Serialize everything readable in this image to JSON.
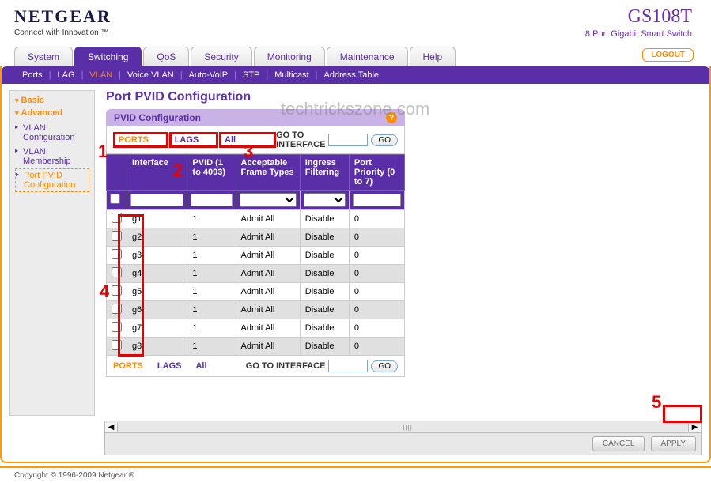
{
  "brand": {
    "name": "NETGEAR",
    "tagline": "Connect with Innovation ™"
  },
  "device": {
    "model": "GS108T",
    "description": "8 Port Gigabit Smart Switch"
  },
  "logout_label": "LOGOUT",
  "main_tabs": [
    "System",
    "Switching",
    "QoS",
    "Security",
    "Monitoring",
    "Maintenance",
    "Help"
  ],
  "main_tabs_active": "Switching",
  "sub_tabs": [
    "Ports",
    "LAG",
    "VLAN",
    "Voice VLAN",
    "Auto-VoIP",
    "STP",
    "Multicast",
    "Address Table"
  ],
  "sub_tabs_active": "VLAN",
  "sidebar": {
    "sections": [
      {
        "label": "Basic",
        "items": []
      },
      {
        "label": "Advanced",
        "items": [
          "VLAN Configuration",
          "VLAN Membership",
          "Port PVID Configuration"
        ],
        "current": "Port PVID Configuration"
      }
    ]
  },
  "page_title": "Port PVID Configuration",
  "panel_title": "PVID Configuration",
  "filters": {
    "links": [
      "PORTS",
      "LAGS",
      "All"
    ],
    "active": "PORTS",
    "goto_label": "GO TO INTERFACE",
    "go_btn": "GO"
  },
  "columns": [
    "Interface",
    "PVID (1 to 4093)",
    "Acceptable Frame Types",
    "Ingress Filtering",
    "Port Priority (0 to 7)"
  ],
  "rows": [
    {
      "interface": "g1",
      "pvid": "1",
      "frame": "Admit All",
      "ingress": "Disable",
      "priority": "0"
    },
    {
      "interface": "g2",
      "pvid": "1",
      "frame": "Admit All",
      "ingress": "Disable",
      "priority": "0"
    },
    {
      "interface": "g3",
      "pvid": "1",
      "frame": "Admit All",
      "ingress": "Disable",
      "priority": "0"
    },
    {
      "interface": "g4",
      "pvid": "1",
      "frame": "Admit All",
      "ingress": "Disable",
      "priority": "0"
    },
    {
      "interface": "g5",
      "pvid": "1",
      "frame": "Admit All",
      "ingress": "Disable",
      "priority": "0"
    },
    {
      "interface": "g6",
      "pvid": "1",
      "frame": "Admit All",
      "ingress": "Disable",
      "priority": "0"
    },
    {
      "interface": "g7",
      "pvid": "1",
      "frame": "Admit All",
      "ingress": "Disable",
      "priority": "0"
    },
    {
      "interface": "g8",
      "pvid": "1",
      "frame": "Admit All",
      "ingress": "Disable",
      "priority": "0"
    }
  ],
  "actions": {
    "cancel": "CANCEL",
    "apply": "APPLY"
  },
  "footer": "Copyright © 1996-2009 Netgear ®",
  "watermark": "techtrickszone.com",
  "annotations": {
    "n1": "1",
    "n2": "2",
    "n3": "3",
    "n4": "4",
    "n5": "5"
  }
}
